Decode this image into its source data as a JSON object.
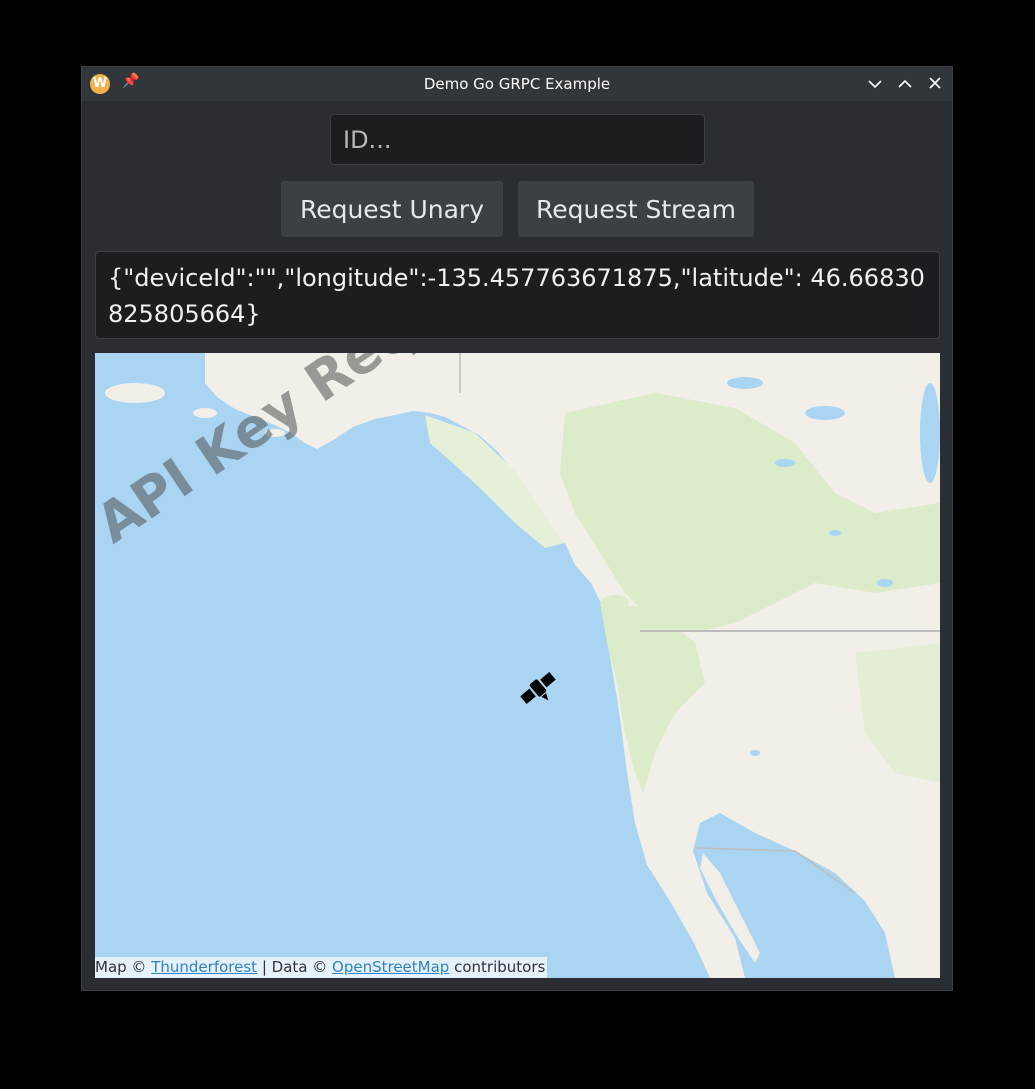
{
  "window": {
    "title": "Demo Go GRPC Example",
    "app_icon_letter": "W"
  },
  "form": {
    "id_placeholder": "ID...",
    "id_value": "",
    "unary_label": "Request Unary",
    "stream_label": "Request Stream"
  },
  "output": {
    "text": "{\"deviceId\":\"\",\"longitude\":-135.457763671875,\"latitude\": 46.66830825805664}"
  },
  "map": {
    "watermark": "API Key Required",
    "marker_icon": "satellite-icon",
    "attribution": {
      "map_prefix": "Map ©",
      "map_link": "Thunderforest",
      "data_prefix": "| Data ©",
      "data_link": "OpenStreetMap",
      "suffix": "contributors"
    }
  },
  "colors": {
    "ocean": "#a9d4f2",
    "land": "#f2efe9",
    "forest": "#dcebc9"
  }
}
